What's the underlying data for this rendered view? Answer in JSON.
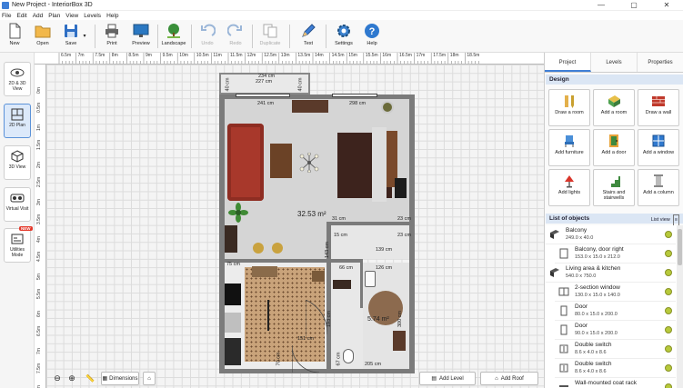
{
  "window": {
    "title": "New Project - InteriorBox 3D",
    "controls": [
      "—",
      "▢",
      "✕"
    ]
  },
  "menu": [
    "File",
    "Edit",
    "Add",
    "Plan",
    "View",
    "Levels",
    "Help"
  ],
  "toolbar": {
    "new": "New",
    "open": "Open",
    "save": "Save",
    "print": "Print",
    "preview": "Preview",
    "landscape": "Landscape",
    "undo": "Undo",
    "redo": "Redo",
    "duplicate": "Duplicate",
    "text": "Text",
    "settings": "Settings",
    "help": "Help"
  },
  "leftbar": {
    "view_2d3d": "2D & 3D View",
    "plan_2d": "2D Plan",
    "view_3d": "3D View",
    "virtual_visit": "Virtual Visit",
    "utilities": "Utilities Mode",
    "new_badge": "NEW"
  },
  "ruler": {
    "h": [
      "6.5m",
      "7m",
      "7.5m",
      "8m",
      "8.5m",
      "9m",
      "9.5m",
      "10m",
      "10.5m",
      "11m",
      "11.5m",
      "12m",
      "12.5m",
      "13m",
      "13.5m",
      "14m",
      "14.5m",
      "15m",
      "15.5m",
      "16m",
      "16.5m",
      "17m",
      "17.5m",
      "18m",
      "18.5m"
    ],
    "v": [
      "0m",
      "0.5m",
      "1m",
      "1.5m",
      "2m",
      "2.5m",
      "3m",
      "3.5m",
      "4m",
      "4.5m",
      "5m",
      "5.5m",
      "6m",
      "6.5m",
      "7m",
      "7.5m",
      "8m"
    ]
  },
  "plan": {
    "dims": {
      "d234": "234 cm",
      "d227": "227 cm",
      "d40a": "40 cm",
      "d40b": "40 cm",
      "d241": "241 cm",
      "d298": "298 cm",
      "d31": "31 cm",
      "d23a": "23 cm",
      "d15": "15 cm",
      "d23b": "23 cm",
      "d139": "139 cm",
      "d143": "143 cm",
      "d66": "66 cm",
      "d126": "126 cm",
      "d75": "75 cm",
      "d193": "193 cm",
      "d300": "300 cm",
      "d151": "151 cm",
      "d70": "70 cm",
      "d205": "205 cm",
      "d67": "67 cm"
    },
    "area_living": "32.53 m²",
    "area_bath": "5.74 m²"
  },
  "bottombar": {
    "dimensions": "Dimensions",
    "add_level": "Add Level",
    "add_roof": "Add Roof"
  },
  "rpanel": {
    "tabs": [
      "Project",
      "Levels",
      "Properties"
    ],
    "design_header": "Design",
    "design_buttons": [
      "Draw a room",
      "Add a room",
      "Draw a wall",
      "Add furniture",
      "Add a door",
      "Add a window",
      "Add lights",
      "Stairs and stairwells",
      "Add a column"
    ],
    "list_header": "List of objects",
    "list_view": "List view",
    "objects": [
      {
        "name": "Balcony",
        "dims": "249.0 x 40.0"
      },
      {
        "name": "Balcony, door right",
        "dims": "153.0 x 15.0 x 212.0"
      },
      {
        "name": "Living area & kitchen",
        "dims": "540.0 x 750.0"
      },
      {
        "name": "2-section window",
        "dims": "130.0 x 15.0 x 140.0"
      },
      {
        "name": "Door",
        "dims": "80.0 x 15.0 x 200.0"
      },
      {
        "name": "Door",
        "dims": "90.0 x 15.0 x 200.0"
      },
      {
        "name": "Double switch",
        "dims": "8.6 x 4.0 x 8.6"
      },
      {
        "name": "Double switch",
        "dims": "8.6 x 4.0 x 8.6"
      },
      {
        "name": "Wall-mounted coat rack",
        "dims": ""
      }
    ]
  },
  "colors": {
    "accent": "#3f7fd6",
    "wall": "#7b7b7b",
    "floor": "#d6d6d6",
    "parquet": "#c9a37a",
    "sofa": "#b33d2e",
    "bed": "#4a2a22"
  }
}
